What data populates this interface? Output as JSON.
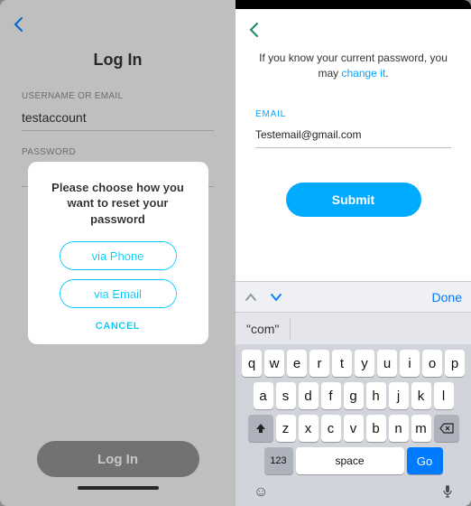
{
  "left": {
    "title": "Log In",
    "username_label": "USERNAME OR EMAIL",
    "username_value": "testaccount",
    "password_label": "PASSWORD",
    "login_btn": "Log In"
  },
  "dialog": {
    "title": "Please choose how you want to reset your password",
    "via_phone": "via Phone",
    "via_email": "via Email",
    "cancel": "CANCEL"
  },
  "right": {
    "info_text_pre": "If you know your current password, you may ",
    "info_link": "change it",
    "info_text_post": ".",
    "email_label": "EMAIL",
    "email_value": "Testemail@gmail.com",
    "submit": "Submit"
  },
  "keyboard": {
    "done": "Done",
    "suggestion": "\"com\"",
    "row1": [
      "q",
      "w",
      "e",
      "r",
      "t",
      "y",
      "u",
      "i",
      "o",
      "p"
    ],
    "row2": [
      "a",
      "s",
      "d",
      "f",
      "g",
      "h",
      "j",
      "k",
      "l"
    ],
    "row3": [
      "z",
      "x",
      "c",
      "v",
      "b",
      "n",
      "m"
    ],
    "numkey": "123",
    "space": "space",
    "go": "Go"
  }
}
